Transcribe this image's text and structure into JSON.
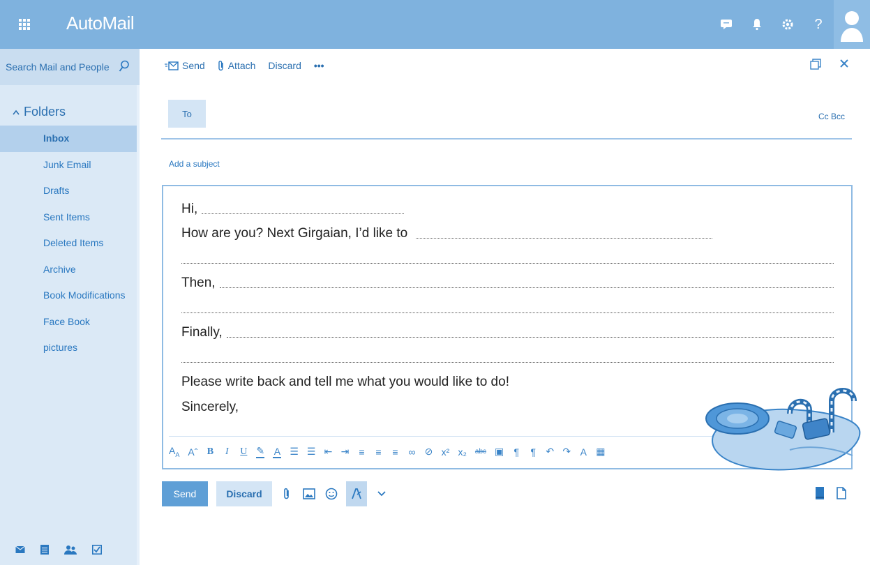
{
  "app": {
    "title": "AutoMail"
  },
  "top_icons": [
    "chat-icon",
    "bell-icon",
    "gear-icon",
    "help-icon",
    "avatar"
  ],
  "search": {
    "placeholder": "Search Mail and People"
  },
  "folders": {
    "heading": "Folders",
    "items": [
      {
        "label": "Inbox",
        "active": true
      },
      {
        "label": "Junk Email"
      },
      {
        "label": "Drafts"
      },
      {
        "label": "Sent Items"
      },
      {
        "label": "Deleted Items"
      },
      {
        "label": "Archive"
      },
      {
        "label": "Book Modifications"
      },
      {
        "label": "Face Book"
      },
      {
        "label": "pictures"
      }
    ]
  },
  "toolbar": {
    "send": "Send",
    "attach": "Attach",
    "discard": "Discard",
    "more": "•••"
  },
  "compose": {
    "to_label": "To",
    "cc_bcc": "Cc Bcc",
    "subject_placeholder": "Add a subject",
    "body": {
      "greeting": "Hi,",
      "line2": "How are you? Next Girgaian, I’d like to",
      "then": "Then,",
      "finally": "Finally,",
      "closing": "Please write back and tell me what you would like to do!",
      "signoff": "Sincerely,"
    }
  },
  "actions": {
    "send": "Send",
    "discard": "Discard"
  },
  "colors": {
    "accent": "#7fb2de",
    "sidebar": "#dbe9f6",
    "active": "#b3d0ec",
    "text": "#2a6fb0"
  }
}
